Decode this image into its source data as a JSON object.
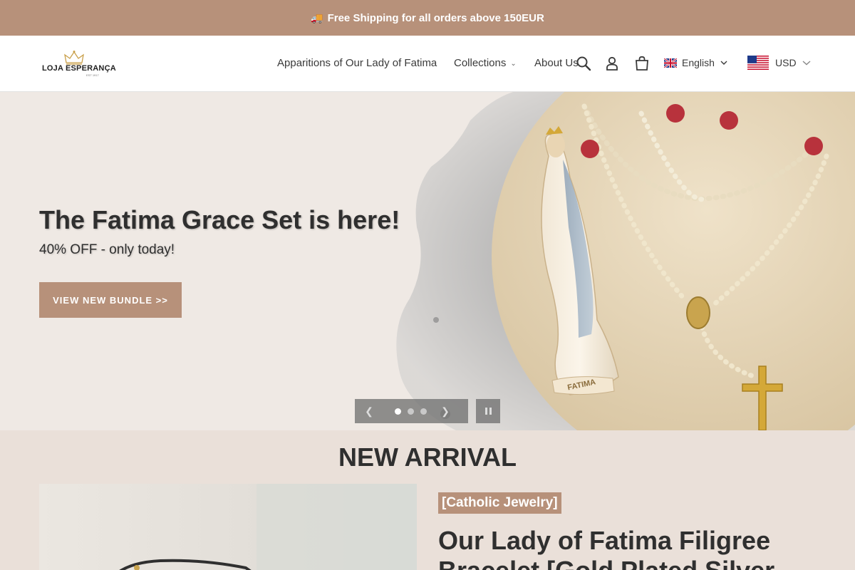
{
  "announcement": {
    "icon": "truck-icon",
    "text": "Free Shipping for all orders above 150EUR"
  },
  "header": {
    "logo": {
      "brand": "LOJA ESPERANÇA",
      "tagline": "EST 1917"
    },
    "nav": [
      {
        "label": "Apparitions of Our Lady of Fatima",
        "has_dropdown": false
      },
      {
        "label": "Collections",
        "has_dropdown": true
      },
      {
        "label": "About Us",
        "has_dropdown": false
      }
    ],
    "icons": [
      "search-icon",
      "account-icon",
      "cart-icon"
    ],
    "language": {
      "label": "English",
      "flag": "uk-flag-icon"
    },
    "currency": {
      "label": "USD",
      "flag": "us-flag-icon"
    }
  },
  "hero": {
    "title": "The Fatima Grace Set is here!",
    "subtitle": "40% OFF - only today!",
    "cta_label": "VIEW NEW BUNDLE >>",
    "slides_total": 3,
    "active_slide": 1,
    "image_text": "FATIMA"
  },
  "arrival": {
    "heading": "NEW ARRIVAL",
    "tag": "[Catholic Jewelry]",
    "product_title": "Our Lady of Fatima Filigree Bracelet [Gold Plated Silver"
  },
  "colors": {
    "accent": "#b7917a",
    "hero_bg": "#efe9e4",
    "section_bg": "#eae0d9",
    "text_dark": "#2f2f2f"
  }
}
